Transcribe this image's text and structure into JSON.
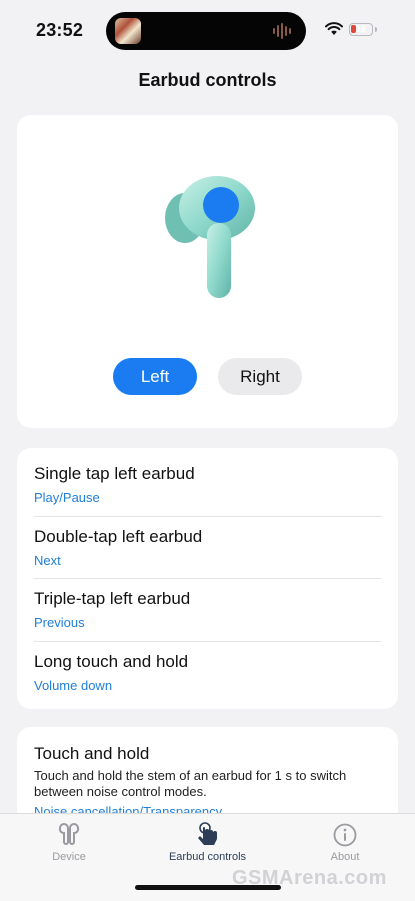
{
  "status_bar": {
    "time": "23:52",
    "battery": "16"
  },
  "header": {
    "title": "Earbud controls"
  },
  "earbud_selector": {
    "left_label": "Left",
    "right_label": "Right",
    "selected": "Left"
  },
  "controls": [
    {
      "title": "Single tap left earbud",
      "value": "Play/Pause"
    },
    {
      "title": "Double-tap left earbud",
      "value": "Next"
    },
    {
      "title": "Triple-tap left earbud",
      "value": "Previous"
    },
    {
      "title": "Long touch and hold",
      "value": "Volume down"
    }
  ],
  "touch_hold": {
    "title": "Touch and hold",
    "description": "Touch and hold the stem of an earbud for 1 s to switch between noise control modes.",
    "value": "Noise cancellation/Transparency"
  },
  "tabs": [
    {
      "label": "Device",
      "icon": "earbuds-icon",
      "active": false
    },
    {
      "label": "Earbud controls",
      "icon": "tap-hand-icon",
      "active": true
    },
    {
      "label": "About",
      "icon": "info-icon",
      "active": false
    }
  ],
  "colors": {
    "accent": "#1a7cf0",
    "link": "#1f7fd6",
    "earbud": "#8fd9cc"
  },
  "watermark": "GSMArena.com"
}
